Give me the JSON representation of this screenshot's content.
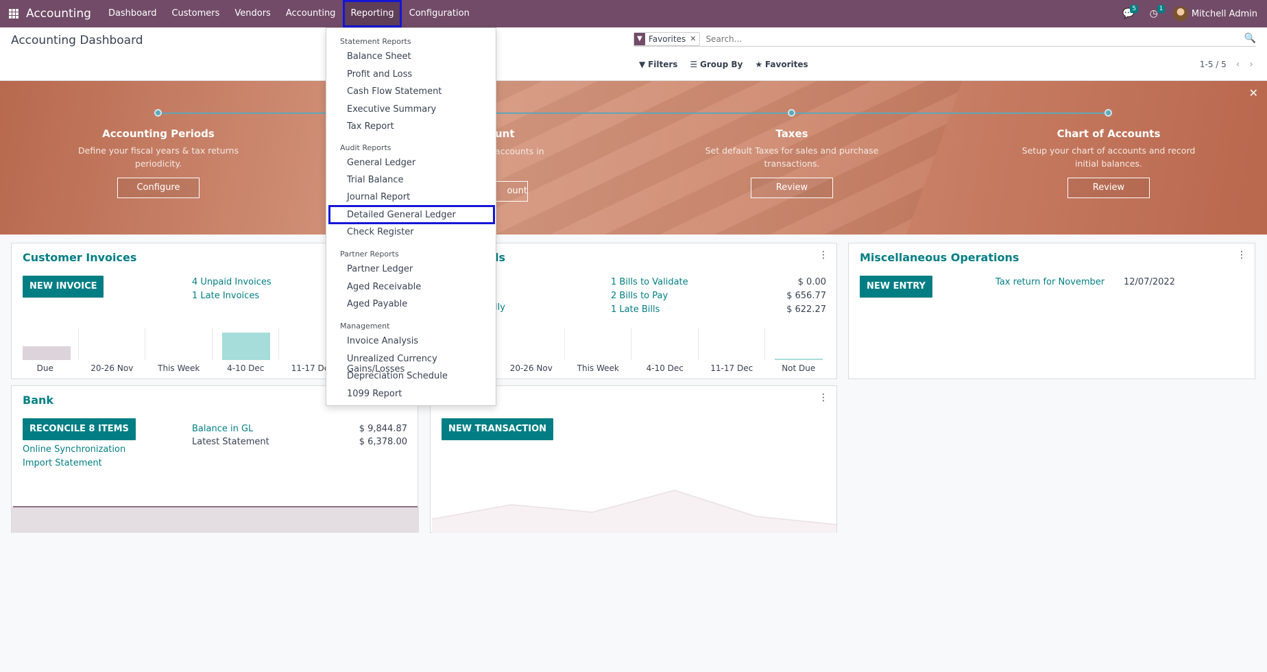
{
  "navbar": {
    "app_name": "Accounting",
    "menu": [
      "Dashboard",
      "Customers",
      "Vendors",
      "Accounting",
      "Reporting",
      "Configuration"
    ],
    "messages_count": "5",
    "activities_count": "1",
    "user": "Mitchell Admin"
  },
  "control_panel": {
    "title": "Accounting Dashboard",
    "facet": "Favorites",
    "search_placeholder": "Search...",
    "filters": "Filters",
    "group_by": "Group By",
    "favorites": "Favorites",
    "pager": "1-5 / 5"
  },
  "banner": {
    "steps": [
      {
        "title": "Accounting Periods",
        "desc1": "Define your fiscal years & tax returns",
        "desc2": "periodicity.",
        "button": "Configure"
      },
      {
        "title_partial": "unt",
        "desc_partial": "accounts in",
        "button_partial": "ount"
      },
      {
        "title": "Taxes",
        "desc1": "Set default Taxes for sales and purchase",
        "desc2": "transactions.",
        "button": "Review"
      },
      {
        "title": "Chart of Accounts",
        "desc1": "Setup your chart of accounts and record",
        "desc2": "initial balances.",
        "button": "Review"
      }
    ]
  },
  "customer_invoices": {
    "title": "Customer Invoices",
    "button": "NEW INVOICE",
    "links": [
      "4 Unpaid Invoices",
      "1 Late Invoices"
    ],
    "graph_labels": [
      "Due",
      "20-26 Nov",
      "This Week",
      "4-10 Dec",
      "11-17 Dec"
    ]
  },
  "vendor_bills": {
    "title_partial": "ls",
    "left_partial": "lly",
    "rows": [
      {
        "label": "1 Bills to Validate",
        "amount": "$ 0.00"
      },
      {
        "label": "2 Bills to Pay",
        "amount": "$ 656.77"
      },
      {
        "label": "1 Late Bills",
        "amount": "$ 622.27"
      }
    ],
    "graph_labels": [
      "20-26 Nov",
      "This Week",
      "4-10 Dec",
      "11-17 Dec",
      "Not Due"
    ]
  },
  "misc": {
    "title": "Miscellaneous Operations",
    "button": "NEW ENTRY",
    "link": "Tax return for November",
    "date": "12/07/2022"
  },
  "bank": {
    "title": "Bank",
    "button": "RECONCILE 8 ITEMS",
    "links": [
      "Online Synchronization",
      "Import Statement"
    ],
    "balance_gl_label": "Balance in GL",
    "balance_gl": "$ 9,844.87",
    "latest_label": "Latest Statement",
    "latest": "$ 6,378.00"
  },
  "cash": {
    "button": "NEW TRANSACTION"
  },
  "reporting_menu": {
    "sections": [
      {
        "header": "Statement Reports",
        "items": [
          "Balance Sheet",
          "Profit and Loss",
          "Cash Flow Statement",
          "Executive Summary",
          "Tax Report"
        ]
      },
      {
        "header": "Audit Reports",
        "items": [
          "General Ledger",
          "Trial Balance",
          "Journal Report",
          "Detailed General Ledger",
          "Check Register"
        ]
      },
      {
        "header": "Partner Reports",
        "items": [
          "Partner Ledger",
          "Aged Receivable",
          "Aged Payable"
        ]
      },
      {
        "header": "Management",
        "items": [
          "Invoice Analysis",
          "Unrealized Currency Gains/Losses",
          "Depreciation Schedule",
          "1099 Report"
        ]
      }
    ]
  }
}
